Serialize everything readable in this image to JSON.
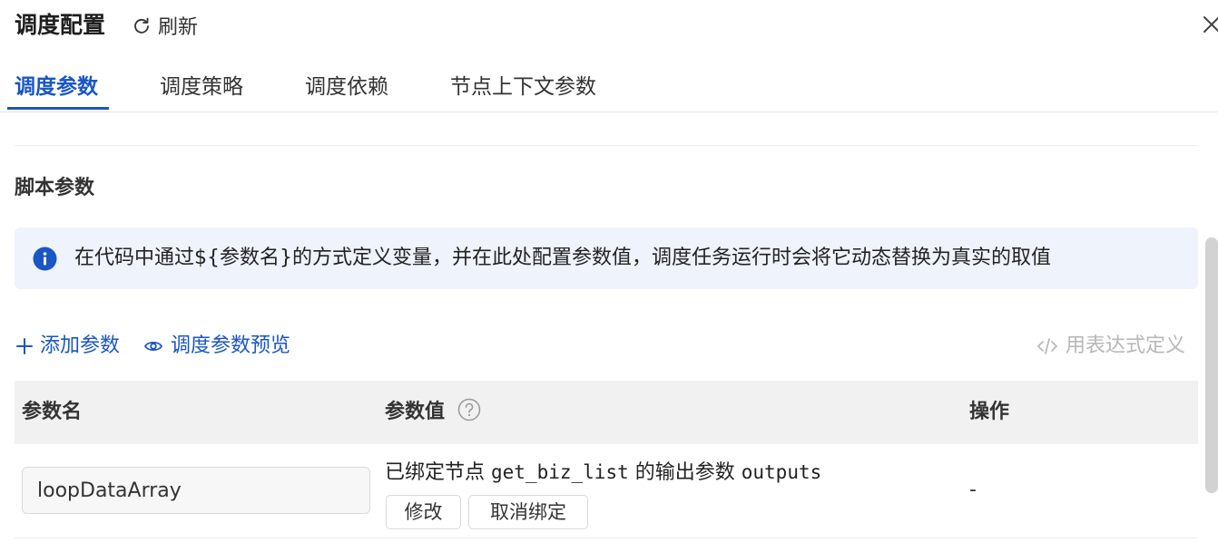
{
  "header": {
    "title": "调度配置",
    "refresh_label": "刷新"
  },
  "tabs": [
    {
      "label": "调度参数",
      "active": true
    },
    {
      "label": "调度策略",
      "active": false
    },
    {
      "label": "调度依赖",
      "active": false
    },
    {
      "label": "节点上下文参数",
      "active": false
    }
  ],
  "section": {
    "title": "脚本参数",
    "info": "在代码中通过${参数名}的方式定义变量，并在此处配置参数值，调度任务运行时会将它动态替换为真实的取值"
  },
  "actions": {
    "add_param": "添加参数",
    "preview": "调度参数预览",
    "expression": "用表达式定义"
  },
  "table": {
    "columns": [
      "参数名",
      "参数值",
      "操作"
    ],
    "rows": [
      {
        "name": "loopDataArray",
        "value_prefix": "已绑定节点",
        "node": "get_biz_list",
        "value_middle": "的输出参数",
        "output": "outputs",
        "buttons": [
          "修改",
          "取消绑定"
        ],
        "operation": "-"
      }
    ]
  },
  "colors": {
    "accent": "#1a56c4",
    "info_bg": "#eef3fc",
    "header_bg": "#f1f1f1",
    "muted": "#b7b7b7"
  },
  "icons": [
    "refresh-icon",
    "close-icon",
    "info-icon",
    "plus-icon",
    "eye-icon",
    "code-icon",
    "help-icon"
  ]
}
